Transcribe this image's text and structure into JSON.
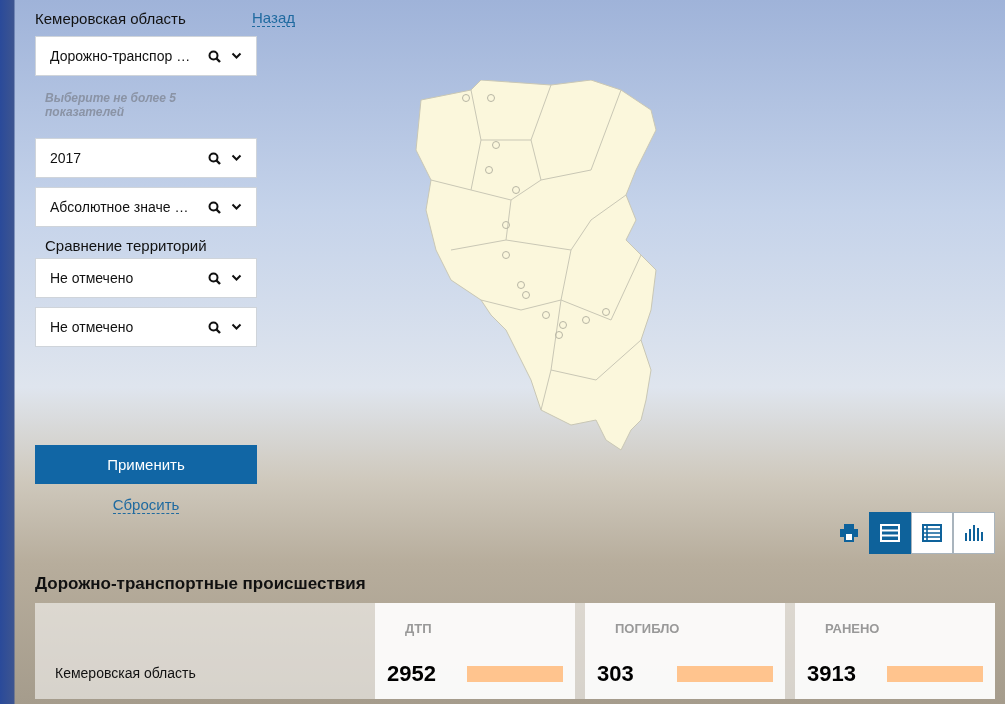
{
  "filter": {
    "region": "Кемеровская область",
    "back_link": "Назад",
    "selects": [
      {
        "value": "Дорожно-транспор …"
      },
      {
        "value": "2017"
      },
      {
        "value": "Абсолютное значе …"
      }
    ],
    "hint": "Выберите не более 5 показателей",
    "comparison_label": "Сравнение территорий",
    "comparison_selects": [
      {
        "value": "Не отмечено"
      },
      {
        "value": "Не отмечено"
      }
    ],
    "apply_button": "Применить",
    "reset_link": "Сбросить"
  },
  "view_buttons": [
    {
      "kind": "rows",
      "selected": true
    },
    {
      "kind": "table",
      "selected": false
    },
    {
      "kind": "chart",
      "selected": false
    }
  ],
  "table": {
    "title": "Дорожно-транспортные происшествия",
    "columns": [
      {
        "label": "ДТП"
      },
      {
        "label": "ПОГИБЛО"
      },
      {
        "label": "РАНЕНО"
      }
    ],
    "rows": [
      {
        "name": "Кемеровская область",
        "cells": [
          {
            "value": "2952"
          },
          {
            "value": "303"
          },
          {
            "value": "3913"
          }
        ]
      }
    ]
  }
}
